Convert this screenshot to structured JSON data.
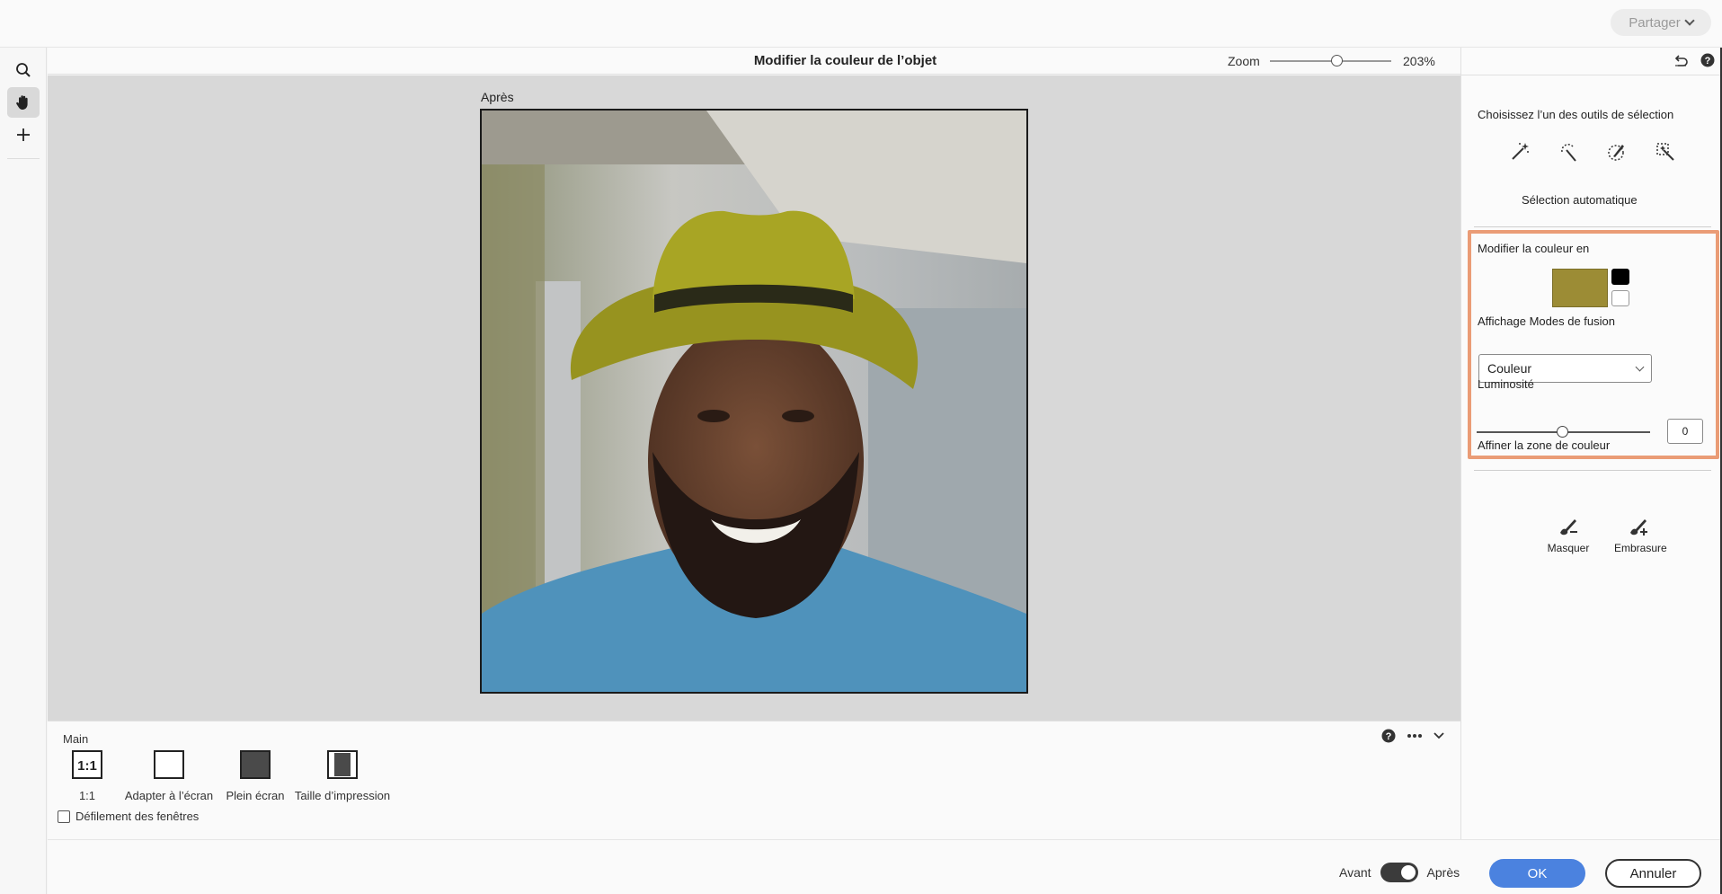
{
  "topbar": {
    "share_label": "Partager"
  },
  "dialog": {
    "title": "Modifier la couleur de l’objet",
    "zoom_label": "Zoom",
    "zoom_value": "203%",
    "zoom_level": 0.55,
    "after_label": "Après"
  },
  "left_tools": [
    "search-icon",
    "hand-icon",
    "plus-icon"
  ],
  "bottom_panel": {
    "title": "Main",
    "views": [
      {
        "label": "1:1",
        "icon": "one-to-one-icon"
      },
      {
        "label": "Adapter à l’écran",
        "icon": "fit-screen-icon"
      },
      {
        "label": "Plein écran",
        "icon": "full-screen-icon"
      },
      {
        "label": "Taille d’impression",
        "icon": "print-size-icon"
      }
    ],
    "scroll_all_label": "Défilement des fenêtres",
    "scroll_all_checked": false,
    "ratio_glyph": "1:1"
  },
  "footer": {
    "before_label": "Avant",
    "after_label": "Après",
    "toggle_on": true,
    "ok_label": "OK",
    "cancel_label": "Annuler"
  },
  "right_panel": {
    "selection_title": "Choisissez l’un des outils de sélection",
    "selection_tools": [
      "magic-wand-icon",
      "quick-selection-icon",
      "selection-brush-icon",
      "auto-selection-icon"
    ],
    "selection_mode": "Sélection automatique",
    "change_color_title": "Modifier la couleur en",
    "target_color": "#9c8c35",
    "blend_title": "Affichage Modes de fusion",
    "blend_value": "Couleur",
    "luminosity_title": "Luminosité",
    "luminosity_value": "0",
    "refine_title": "Affiner la zone de couleur",
    "refine_tools": [
      {
        "label": "Masquer",
        "icon": "brush-minus-icon"
      },
      {
        "label": "Embrasure",
        "icon": "brush-plus-icon"
      }
    ],
    "highlight_color": "#ea9c76"
  }
}
